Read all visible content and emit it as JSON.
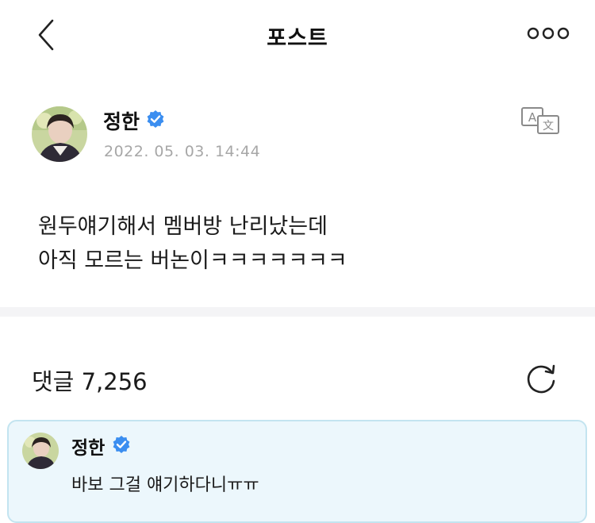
{
  "header": {
    "title": "포스트",
    "back_icon": "chevron-left-icon",
    "more_icon": "more-horizontal-icon"
  },
  "post": {
    "author": "정한",
    "verified": true,
    "timestamp": "2022. 05. 03. 14:44",
    "translate_icon": "translate-icon",
    "lines": [
      "원두얘기해서 멤버방 난리났는데",
      "아직 모르는 버논이ㅋㅋㅋㅋㅋㅋㅋ"
    ]
  },
  "comments": {
    "label": "댓글 7,256",
    "refresh_icon": "refresh-icon",
    "items": [
      {
        "author": "정한",
        "verified": true,
        "text": "바보 그걸 얘기하다니ㅠㅠ"
      }
    ]
  },
  "colors": {
    "verified": "#3b8ef0",
    "timestamp": "#a7a7a7",
    "comment_bg": "#ecf7fc",
    "comment_border": "#c3e4f0",
    "divider": "#f4f4f6"
  }
}
